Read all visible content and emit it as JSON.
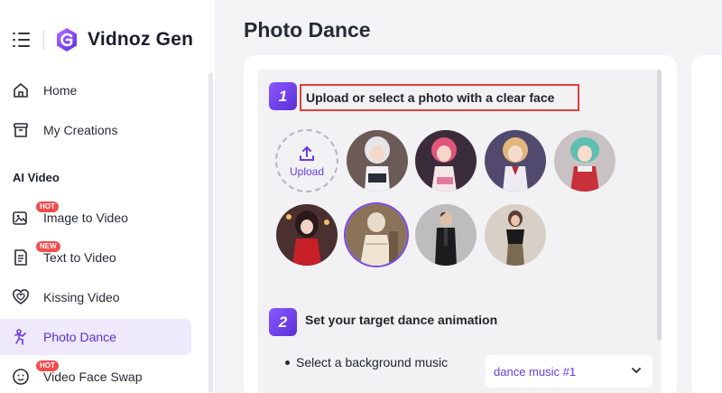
{
  "brand": {
    "name": "Vidnoz Gen"
  },
  "sidebar": {
    "items": [
      {
        "label": "Home",
        "icon": "home-icon"
      },
      {
        "label": "My Creations",
        "icon": "archive-icon"
      }
    ],
    "section_title": "AI Video",
    "video_items": [
      {
        "label": "Image to Video",
        "icon": "image-video-icon",
        "badge": "HOT"
      },
      {
        "label": "Text to Video",
        "icon": "text-doc-icon",
        "badge": "NEW"
      },
      {
        "label": "Kissing Video",
        "icon": "hearts-icon",
        "badge": ""
      },
      {
        "label": "Photo Dance",
        "icon": "dance-icon",
        "badge": "",
        "active": true
      },
      {
        "label": "Video Face Swap",
        "icon": "face-swap-icon",
        "badge": "HOT"
      }
    ]
  },
  "main": {
    "title": "Photo Dance",
    "step1": {
      "number": "1",
      "label": "Upload or select a photo with a clear face",
      "upload_label": "Upload"
    },
    "step2": {
      "number": "2",
      "label": "Set your target dance animation"
    },
    "music": {
      "label": "Select a background music",
      "value": "dance music #1"
    }
  },
  "colors": {
    "accent": "#6a3ae6",
    "highlight": "#e23b3b",
    "active_bg": "#efe9fc"
  }
}
